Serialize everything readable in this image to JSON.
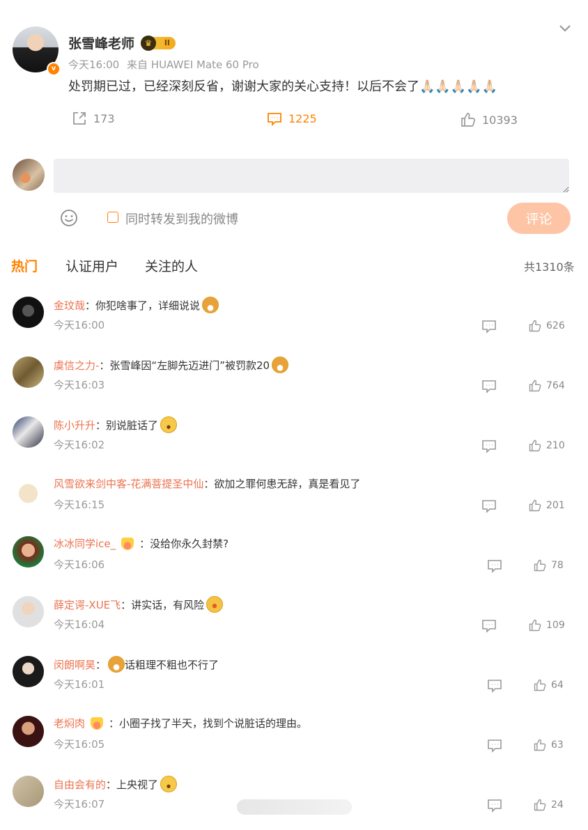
{
  "post": {
    "author": "张雪峰老师",
    "vip_level": "II",
    "time": "今天16:00",
    "source": "来自 HUAWEI Mate 60 Pro",
    "text": "处罚期已过，已经深刻反省，谢谢大家的关心支持！以后不会了🙏🏻🙏🏻🙏🏻🙏🏻🙏🏻",
    "reposts": "173",
    "comments": "1225",
    "likes": "10393"
  },
  "composer": {
    "placeholder": "",
    "repost_label": "同时转发到我的微博",
    "submit_label": "评论"
  },
  "tabs": [
    {
      "label": "热门"
    },
    {
      "label": "认证用户"
    },
    {
      "label": "关注的人"
    }
  ],
  "total_label": "共1310条",
  "comments": [
    {
      "user": "金玟哉",
      "text": "：你犯啥事了，详细说说",
      "emoji": "dog",
      "time": "今天16:00",
      "likes": "626"
    },
    {
      "user": "虞信之力-",
      "text": "：张雪峰因“左脚先迈进门”被罚款20",
      "emoji": "dog",
      "time": "今天16:03",
      "likes": "764"
    },
    {
      "user": "陈小升升",
      "text": "：别说脏话了",
      "emoji": "cry",
      "time": "今天16:02",
      "likes": "210"
    },
    {
      "user": "风雪欲来剑中客-花满菩提圣中仙",
      "text": "：欲加之罪何患无辞，真是看见了",
      "emoji": "",
      "time": "今天16:15",
      "likes": "201"
    },
    {
      "user": "冰冰同学ice_",
      "text": "：没给你永久封禁?",
      "emoji": "",
      "time": "今天16:06",
      "likes": "78"
    },
    {
      "user": "薛定谔-XUE飞",
      "text": "：讲实话，有风险",
      "emoji": "fire",
      "time": "今天16:04",
      "likes": "109"
    },
    {
      "user": "闵朗啊昊",
      "text": "话粗理不粗也不行了",
      "emoji": "dog",
      "time": "今天16:01",
      "likes": "64"
    },
    {
      "user": "老焖肉",
      "text": "：小圈子找了半天，找到个说脏话的理由。",
      "emoji": "",
      "time": "今天16:05",
      "likes": "63"
    },
    {
      "user": "自由会有的",
      "text": "：上央视了",
      "emoji": "cry",
      "time": "今天16:07",
      "likes": "24"
    }
  ],
  "colors": {
    "accent": "#ff8200",
    "username": "#eb7350",
    "submit_disabled": "#fdc5a5"
  }
}
